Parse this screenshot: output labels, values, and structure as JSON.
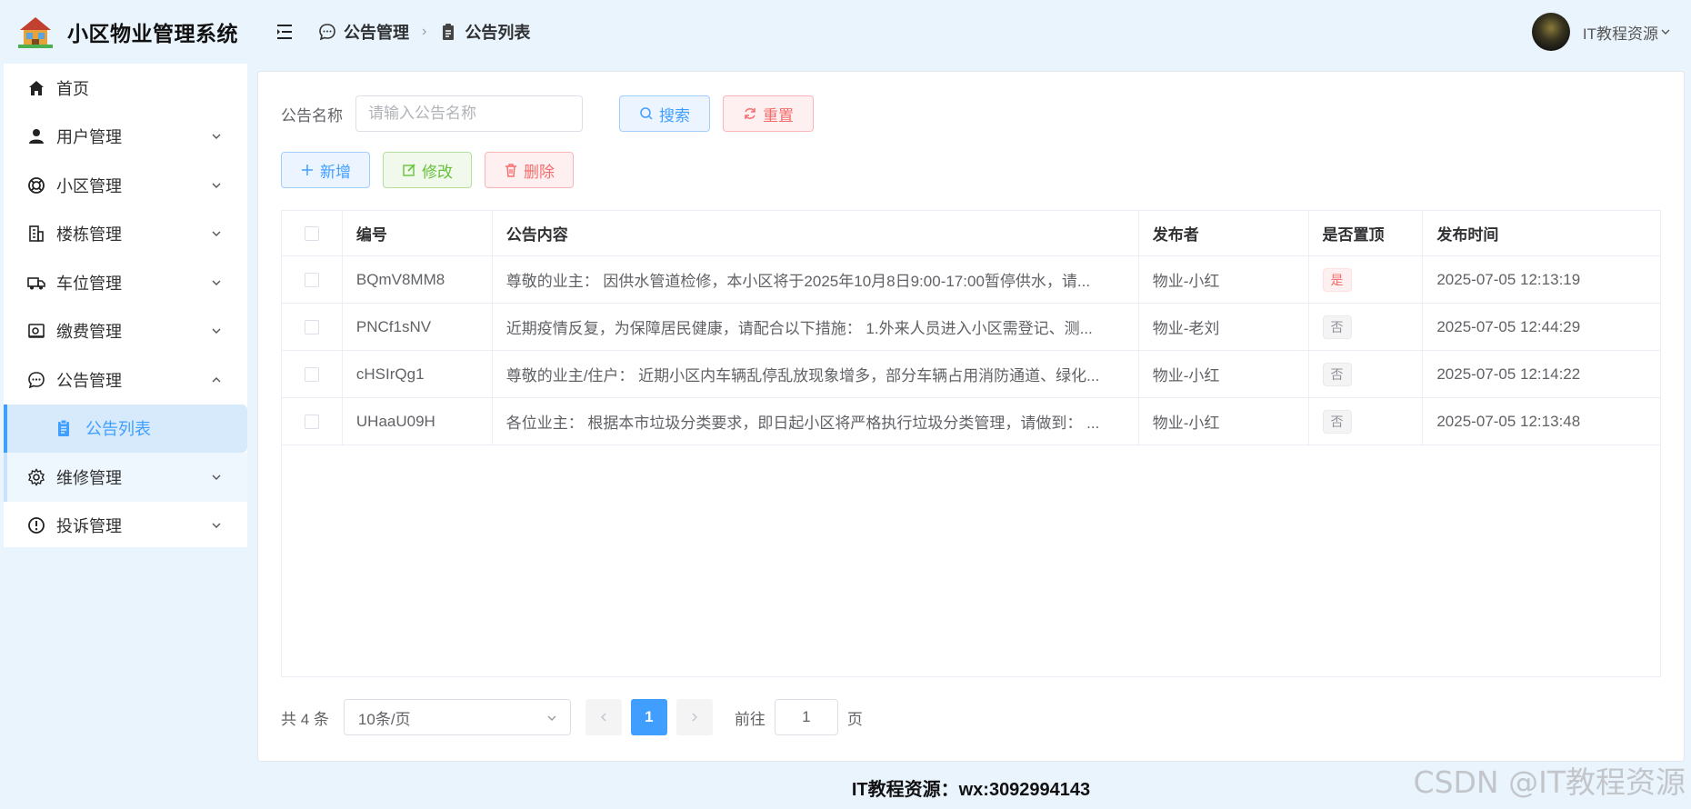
{
  "app": {
    "title": "小区物业管理系统"
  },
  "sidebar": {
    "items": [
      {
        "label": "首页",
        "icon": "home-icon"
      },
      {
        "label": "用户管理",
        "icon": "user-icon"
      },
      {
        "label": "小区管理",
        "icon": "lifebuoy-icon"
      },
      {
        "label": "楼栋管理",
        "icon": "building-icon"
      },
      {
        "label": "车位管理",
        "icon": "truck-icon"
      },
      {
        "label": "缴费管理",
        "icon": "wallet-icon"
      },
      {
        "label": "公告管理",
        "icon": "chat-icon"
      },
      {
        "label": "公告列表",
        "icon": "clipboard-icon"
      },
      {
        "label": "维修管理",
        "icon": "gear-icon"
      },
      {
        "label": "投诉管理",
        "icon": "warning-icon"
      }
    ]
  },
  "header": {
    "breadcrumb": [
      "公告管理",
      "公告列表"
    ],
    "user_name": "IT教程资源"
  },
  "search": {
    "label": "公告名称",
    "placeholder": "请输入公告名称",
    "search_btn": "搜索",
    "reset_btn": "重置"
  },
  "actions": {
    "add": "新增",
    "edit": "修改",
    "delete": "删除"
  },
  "table": {
    "columns": [
      "编号",
      "公告内容",
      "发布者",
      "是否置顶",
      "发布时间"
    ],
    "rows": [
      {
        "id": "BQmV8MM8",
        "content": "尊敬的业主： 因供水管道检修，本小区将于2025年10月8日9:00-17:00暂停供水，请...",
        "publisher": "物业-小红",
        "pinned": "是",
        "time": "2025-07-05 12:13:19"
      },
      {
        "id": "PNCf1sNV",
        "content": "近期疫情反复，为保障居民健康，请配合以下措施： 1.外来人员进入小区需登记、测...",
        "publisher": "物业-老刘",
        "pinned": "否",
        "time": "2025-07-05 12:44:29"
      },
      {
        "id": "cHSIrQg1",
        "content": "尊敬的业主/住户： 近期小区内车辆乱停乱放现象增多，部分车辆占用消防通道、绿化...",
        "publisher": "物业-小红",
        "pinned": "否",
        "time": "2025-07-05 12:14:22"
      },
      {
        "id": "UHaaU09H",
        "content": "各位业主： 根据本市垃圾分类要求，即日起小区将严格执行垃圾分类管理，请做到： ...",
        "publisher": "物业-小红",
        "pinned": "否",
        "time": "2025-07-05 12:13:48"
      }
    ]
  },
  "pagination": {
    "total": "共 4 条",
    "page_size": "10条/页",
    "current": "1",
    "goto_label": "前往",
    "goto_value": "1",
    "page_suffix": "页"
  },
  "footer": {
    "text": "IT教程资源：wx:3092994143"
  },
  "watermark": "CSDN @IT教程资源",
  "colors": {
    "primary": "#409eff",
    "danger": "#f56c6c",
    "success": "#67c23a",
    "sidebar_bg": "#eaf4fd"
  }
}
